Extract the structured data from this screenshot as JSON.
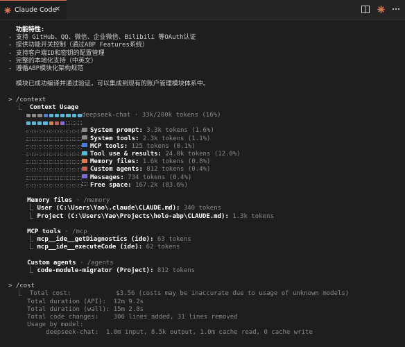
{
  "tab": {
    "title": "Claude Code",
    "icon": "claude-sparkle-icon",
    "close": "✕"
  },
  "actions": [
    {
      "name": "split-editor-icon"
    },
    {
      "name": "claude-sparkle-icon"
    },
    {
      "name": "more-actions-icon"
    }
  ],
  "colors": {
    "accent": "#d97757",
    "system_prompt": "#8a8a8a",
    "system_tools": "#8a8a8a",
    "mcp_tools": "#4a7fd8",
    "tool_use": "#5bb8d6",
    "memory_files": "#d9804f",
    "custom_agents": "#c75c5c",
    "messages": "#7c6cd4"
  },
  "intro": {
    "heading": "功能特性:",
    "bullets": [
      "- 支持 GitHub、QQ、微信、企业微信、Bilibili 等OAuth认证",
      "- 提供功能开关控制（通过ABP Features系统）",
      "- 支持客户端ID和密钥的配置管理",
      "- 完整的本地化支持（中英文）",
      "- 遵循ABP模块化架构规范"
    ],
    "summary": "模块已成功编译并通过验证，可以集成到现有的账户管理模块体系中。"
  },
  "context": {
    "command": "> /context",
    "title": "Context Usage",
    "title_prefix": "  ⎿  ",
    "model_line": "deepseek-chat · 33k/200k tokens (16%)",
    "categories": [
      {
        "key": "system_prompt",
        "label": "System prompt:",
        "value": "3.3k tokens (1.6%)"
      },
      {
        "key": "system_tools",
        "label": "System tools:",
        "value": "2.3k tokens (1.1%)"
      },
      {
        "key": "mcp_tools",
        "label": "MCP tools:",
        "value": "125 tokens (0.1%)"
      },
      {
        "key": "tool_use",
        "label": "Tool use & results:",
        "value": "24.0k tokens (12.0%)"
      },
      {
        "key": "memory_files",
        "label": "Memory files:",
        "value": "1.6k tokens (0.8%)"
      },
      {
        "key": "custom_agents",
        "label": "Custom agents:",
        "value": "812 tokens (0.4%)"
      },
      {
        "key": "messages",
        "label": "Messages:",
        "value": "734 tokens (0.4%)"
      },
      {
        "key": "free",
        "label": "Free space:",
        "value": "167.2k (83.6%)"
      }
    ],
    "grid_rows": [
      [
        "system_prompt",
        "system_prompt",
        "system_tools",
        "mcp_tools",
        "tool_use",
        "tool_use",
        "tool_use",
        "tool_use",
        "tool_use",
        "tool_use"
      ],
      [
        "tool_use",
        "tool_use",
        "tool_use",
        "tool_use",
        "memory_files",
        "custom_agents",
        "messages",
        "free",
        "free",
        "free"
      ],
      [
        "free",
        "free",
        "free",
        "free",
        "free",
        "free",
        "free",
        "free",
        "free",
        "free"
      ],
      [
        "free",
        "free",
        "free",
        "free",
        "free",
        "free",
        "free",
        "free",
        "free",
        "free"
      ],
      [
        "free",
        "free",
        "free",
        "free",
        "free",
        "free",
        "free",
        "free",
        "free",
        "free"
      ],
      [
        "free",
        "free",
        "free",
        "free",
        "free",
        "free",
        "free",
        "free",
        "free",
        "free"
      ],
      [
        "free",
        "free",
        "free",
        "free",
        "free",
        "free",
        "free",
        "free",
        "free",
        "free"
      ],
      [
        "free",
        "free",
        "free",
        "free",
        "free",
        "free",
        "free",
        "free",
        "free",
        "free"
      ],
      [
        "free",
        "free",
        "free",
        "free",
        "free",
        "free",
        "free",
        "free",
        "free",
        "free"
      ],
      [
        "free",
        "free",
        "free",
        "free",
        "free",
        "free",
        "free",
        "free",
        "free",
        "free"
      ]
    ],
    "memory": {
      "heading": "Memory files",
      "sub": " · /memory",
      "items": [
        {
          "label": "User (C:\\Users\\Yao\\.claude\\CLAUDE.md):",
          "value": " 340 tokens"
        },
        {
          "label": "Project (C:\\Users\\Yao\\Projects\\holo-abp\\CLAUDE.md):",
          "value": " 1.3k tokens"
        }
      ]
    },
    "mcp": {
      "heading": "MCP tools",
      "sub": " · /mcp",
      "items": [
        {
          "label": "mcp__ide__getDiagnostics (ide):",
          "value": " 63 tokens"
        },
        {
          "label": "mcp__ide__executeCode (ide):",
          "value": " 62 tokens"
        }
      ]
    },
    "agents": {
      "heading": "Custom agents",
      "sub": " · /agents",
      "items": [
        {
          "label": "code-module-migrator (Project):",
          "value": " 812 tokens"
        }
      ]
    }
  },
  "cost": {
    "command": "> /cost",
    "rows": [
      "  ⎿  Total cost:            $3.56 (costs may be inaccurate due to usage of unknown models)",
      "     Total duration (API):  12m 9.2s",
      "     Total duration (wall): 15m 2.8s",
      "     Total code changes:    306 lines added, 31 lines removed",
      "     Usage by model:",
      "          deepseek-chat:  1.0m input, 8.5k output, 1.0m cache read, 0 cache write"
    ]
  }
}
